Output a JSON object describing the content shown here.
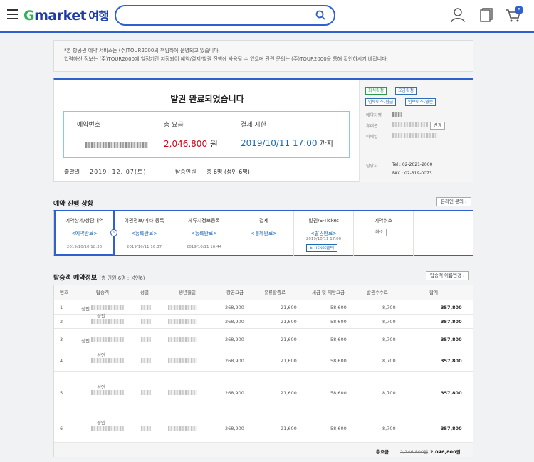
{
  "header": {
    "logo_g": "G",
    "logo_market": "market",
    "logo_travel": "여행",
    "search_placeholder": "",
    "cart_count": "6"
  },
  "notice": {
    "line1": "*본 항공권 예약 서비스는 (주)TOUR2000의 책임하에 운영되고 있습니다.",
    "line2": "입력하신 정보는 (주)TOUR2000에 일정기간 저장되어 예약/결제/발권 진행에 사용될 수 있으며 관련 문의는 (주)TOUR2000을 통해 확인하시기 바랍니다."
  },
  "summary": {
    "title": "발권 완료되었습니다",
    "reservation_label": "예약번호",
    "fare_label": "총 요금",
    "fare_value": "2,046,800",
    "fare_unit": "원",
    "deadline_label": "결제 시한",
    "deadline_value": "2019/10/11 17:00",
    "deadline_suffix": "까지",
    "departure_label": "출발일",
    "departure_value": "2019. 12. 07(토)",
    "pax_label": "탑승인원",
    "pax_value": "총 6명",
    "pax_detail": "(성인 6명)",
    "tags": [
      "좌석확정",
      "요금확정",
      "인보이스-한글",
      "인보이스-영문"
    ],
    "reserver_label": "예약자명",
    "phone_label": "휴대폰",
    "email_label": "이메일",
    "change_button": "변경",
    "agent_label": "담당자",
    "tel": "Tel : 02-2021-2000",
    "fax": "FAX : 02-319-0073"
  },
  "progress": {
    "title": "예약 진행 상황",
    "inquiry_button": "온라인 문의",
    "steps": [
      {
        "title": "예약상세/상담내역",
        "status": "<예약완료>",
        "date": "2019/10/10 18:36"
      },
      {
        "title": "여권정보/기타 등록",
        "status": "<등록완료>",
        "date": "2019/10/11 16:37"
      },
      {
        "title": "체류지정보등록",
        "status": "<등록완료>",
        "date": "2019/10/11 16:44"
      },
      {
        "title": "결제",
        "status": "<결제완료>",
        "date": ""
      },
      {
        "title": "발권/E-Ticket",
        "status": "<발권완료>",
        "date": "2019/10/11 17:00"
      },
      {
        "title": "예약취소",
        "status": "",
        "date": ""
      }
    ],
    "eticket_button": "E-Ticket출력",
    "cancel_button": "취소"
  },
  "passengers": {
    "title": "탑승객 예약정보",
    "subtitle": "(총 인원 6명 : 성인6)",
    "rename_button": "탑승객 이름변경",
    "columns": [
      "번호",
      "탑승객",
      "성별",
      "생년월일",
      "항공요금",
      "유류할증료",
      "세금 및 제반요금",
      "발권수수료",
      "합계"
    ],
    "rows": [
      {
        "no": "1",
        "type": "성인",
        "fare": "268,900",
        "fuel": "21,600",
        "tax": "58,600",
        "fee": "8,700",
        "total": "357,800"
      },
      {
        "no": "2",
        "type": "성인",
        "fare": "268,900",
        "fuel": "21,600",
        "tax": "58,600",
        "fee": "8,700",
        "total": "357,800"
      },
      {
        "no": "3",
        "type": "성인",
        "fare": "268,900",
        "fuel": "21,600",
        "tax": "58,600",
        "fee": "8,700",
        "total": "357,800"
      },
      {
        "no": "4",
        "type": "성인",
        "fare": "268,900",
        "fuel": "21,600",
        "tax": "58,600",
        "fee": "8,700",
        "total": "357,800"
      },
      {
        "no": "5",
        "type": "성인",
        "fare": "268,900",
        "fuel": "21,600",
        "tax": "58,600",
        "fee": "8,700",
        "total": "357,800"
      },
      {
        "no": "6",
        "type": "성인",
        "fare": "268,900",
        "fuel": "21,600",
        "tax": "58,600",
        "fee": "8,700",
        "total": "357,800"
      }
    ],
    "total_label": "총요금",
    "total_original": "2,146,800원",
    "total_final": "2,046,800원"
  }
}
